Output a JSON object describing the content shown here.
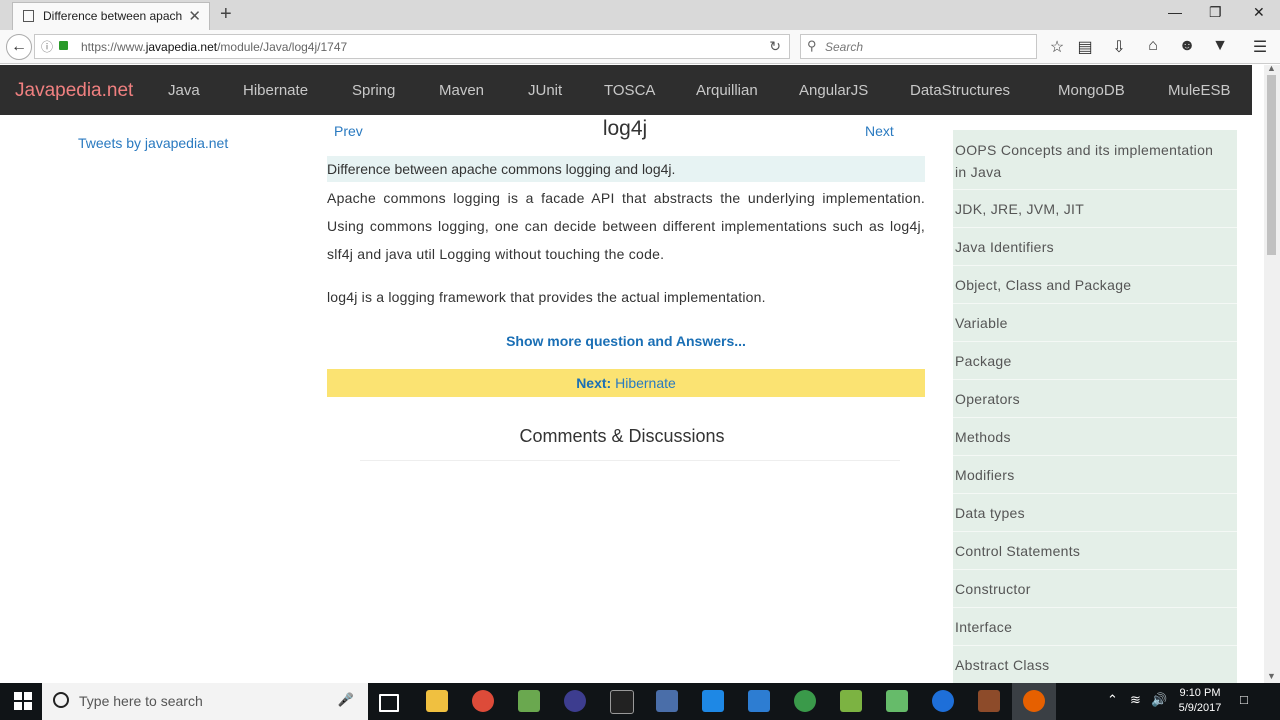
{
  "browser": {
    "tab_title": "Difference between apach...",
    "tab_close": "✕",
    "new_tab": "+",
    "window_controls": {
      "minimize": "—",
      "maximize": "❐",
      "close": "✕"
    },
    "url_prefix": "https://www.",
    "url_domain": "javapedia.net",
    "url_path": "/module/Java/log4j/1747",
    "search_placeholder": "Search"
  },
  "site": {
    "brand": "Javapedia.net",
    "nav": [
      "Java",
      "Hibernate",
      "Spring",
      "Maven",
      "JUnit",
      "TOSCA",
      "Arquillian",
      "AngularJS",
      "DataStructures",
      "MongoDB",
      "MuleESB"
    ]
  },
  "page": {
    "tweets_link": "Tweets by javapedia.net",
    "prev": "Prev",
    "next": "Next",
    "title": "log4j",
    "question": "Difference between apache commons logging and log4j.",
    "answer_p1": "Apache commons logging is a facade API that abstracts the underlying implementation. Using commons logging, one can decide between different implementations such as log4j, slf4j and java util Logging without touching the code.",
    "answer_p2": "log4j is a logging framework that provides the actual implementation.",
    "show_more": "Show more question and Answers...",
    "next_label": "Next:",
    "next_topic": "Hibernate",
    "comments_heading": "Comments & Discussions"
  },
  "sidebar": {
    "items": [
      "OOPS Concepts and its implementation in Java",
      "JDK, JRE, JVM, JIT",
      "Java Identifiers",
      "Object, Class and Package",
      "Variable",
      "Package",
      "Operators",
      "Methods",
      "Modifiers",
      "Data types",
      "Control Statements",
      "Constructor",
      "Interface",
      "Abstract Class"
    ]
  },
  "taskbar": {
    "search_placeholder": "Type here to search",
    "time": "9:10 PM",
    "date": "5/9/2017"
  },
  "colors": {
    "nav_bg": "#2e2e2e",
    "brand": "#f08080",
    "link": "#2a7ac0",
    "next_bar": "#fbe372",
    "sidebar_bg": "#e4efe8",
    "question_bg": "#e7f3f3"
  },
  "icons": [
    "reader-icon",
    "info-icon",
    "lock-icon",
    "reload-icon",
    "search-icon",
    "star-icon",
    "library-icon",
    "download-icon",
    "home-icon",
    "chat-icon",
    "pocket-icon",
    "menu-icon",
    "windows-start-icon",
    "cortana-icon",
    "mic-icon",
    "task-view-icon",
    "file-explorer-icon",
    "chrome-icon",
    "firefox-icon",
    "edge-icon"
  ]
}
